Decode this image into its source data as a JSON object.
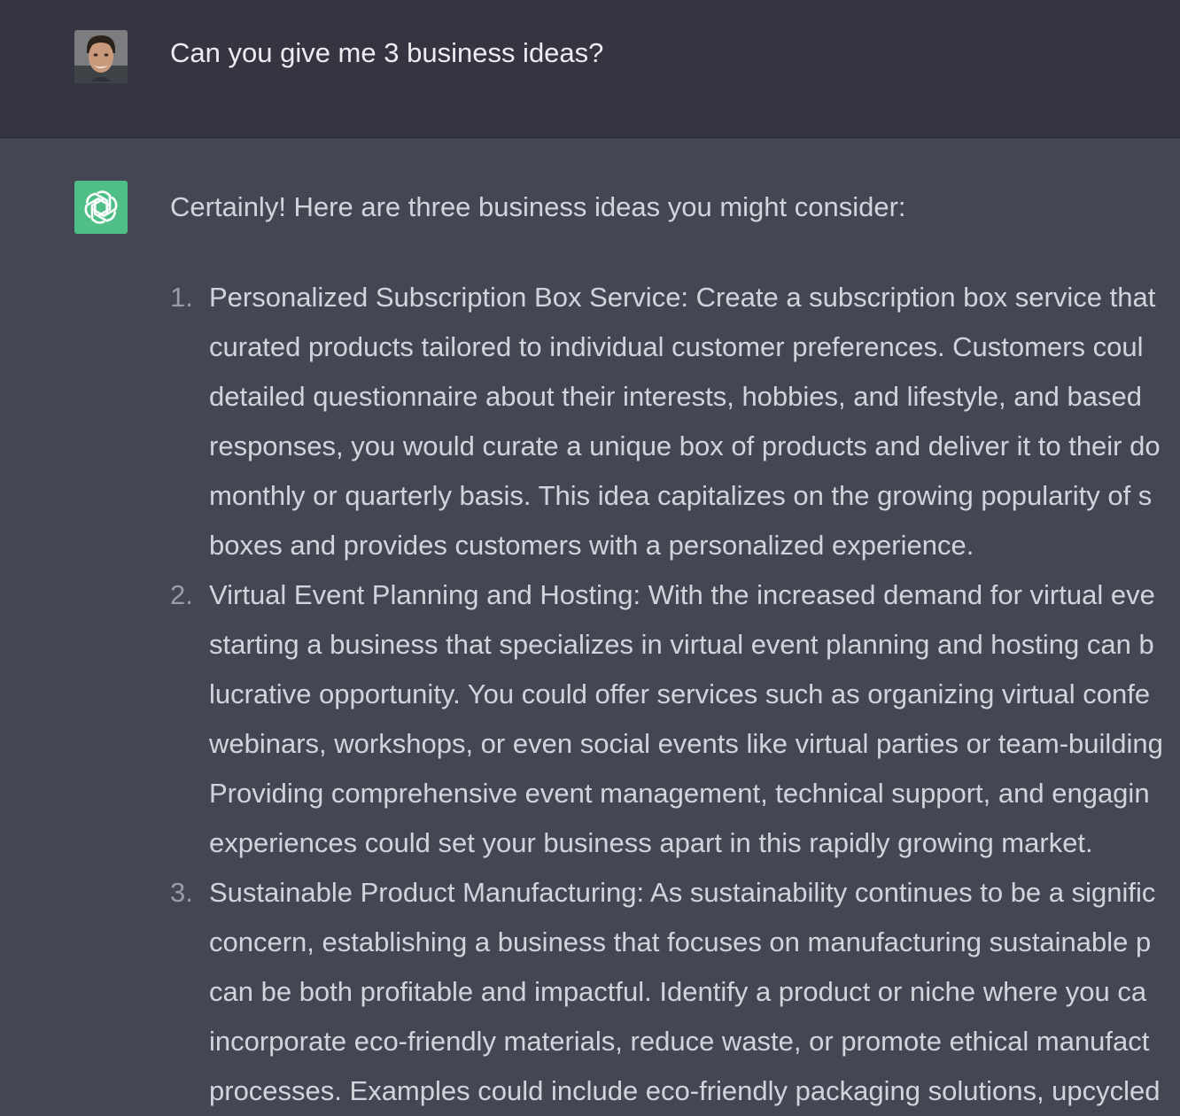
{
  "user_message": {
    "text": "Can you give me 3 business ideas?"
  },
  "assistant_message": {
    "intro": "Certainly! Here are three business ideas you might consider:",
    "ideas": [
      {
        "number": "1.",
        "lines": [
          "Personalized Subscription Box Service: Create a subscription box service that",
          "curated products tailored to individual customer preferences. Customers coul",
          "detailed questionnaire about their interests, hobbies, and lifestyle, and based",
          "responses, you would curate a unique box of products and deliver it to their do",
          "monthly or quarterly basis. This idea capitalizes on the growing popularity of s",
          "boxes and provides customers with a personalized experience."
        ]
      },
      {
        "number": "2.",
        "lines": [
          "Virtual Event Planning and Hosting: With the increased demand for virtual eve",
          "starting a business that specializes in virtual event planning and hosting can b",
          "lucrative opportunity. You could offer services such as organizing virtual confe",
          "webinars, workshops, or even social events like virtual parties or team-building",
          "Providing comprehensive event management, technical support, and engagin",
          "experiences could set your business apart in this rapidly growing market."
        ]
      },
      {
        "number": "3.",
        "lines": [
          "Sustainable Product Manufacturing: As sustainability continues to be a signific",
          "concern, establishing a business that focuses on manufacturing sustainable p",
          "can be both profitable and impactful. Identify a product or niche where you ca",
          "incorporate eco-friendly materials, reduce waste, or promote ethical manufact",
          "processes. Examples could include eco-friendly packaging solutions, upcycled"
        ]
      }
    ]
  },
  "icons": {
    "user_avatar": "user-avatar-photo",
    "assistant_avatar": "openai-logo-icon"
  },
  "colors": {
    "user_row_bg": "#343541",
    "assistant_row_bg": "#444654",
    "assistant_icon_bg": "#4fbf87",
    "text": "#d1d5db"
  }
}
